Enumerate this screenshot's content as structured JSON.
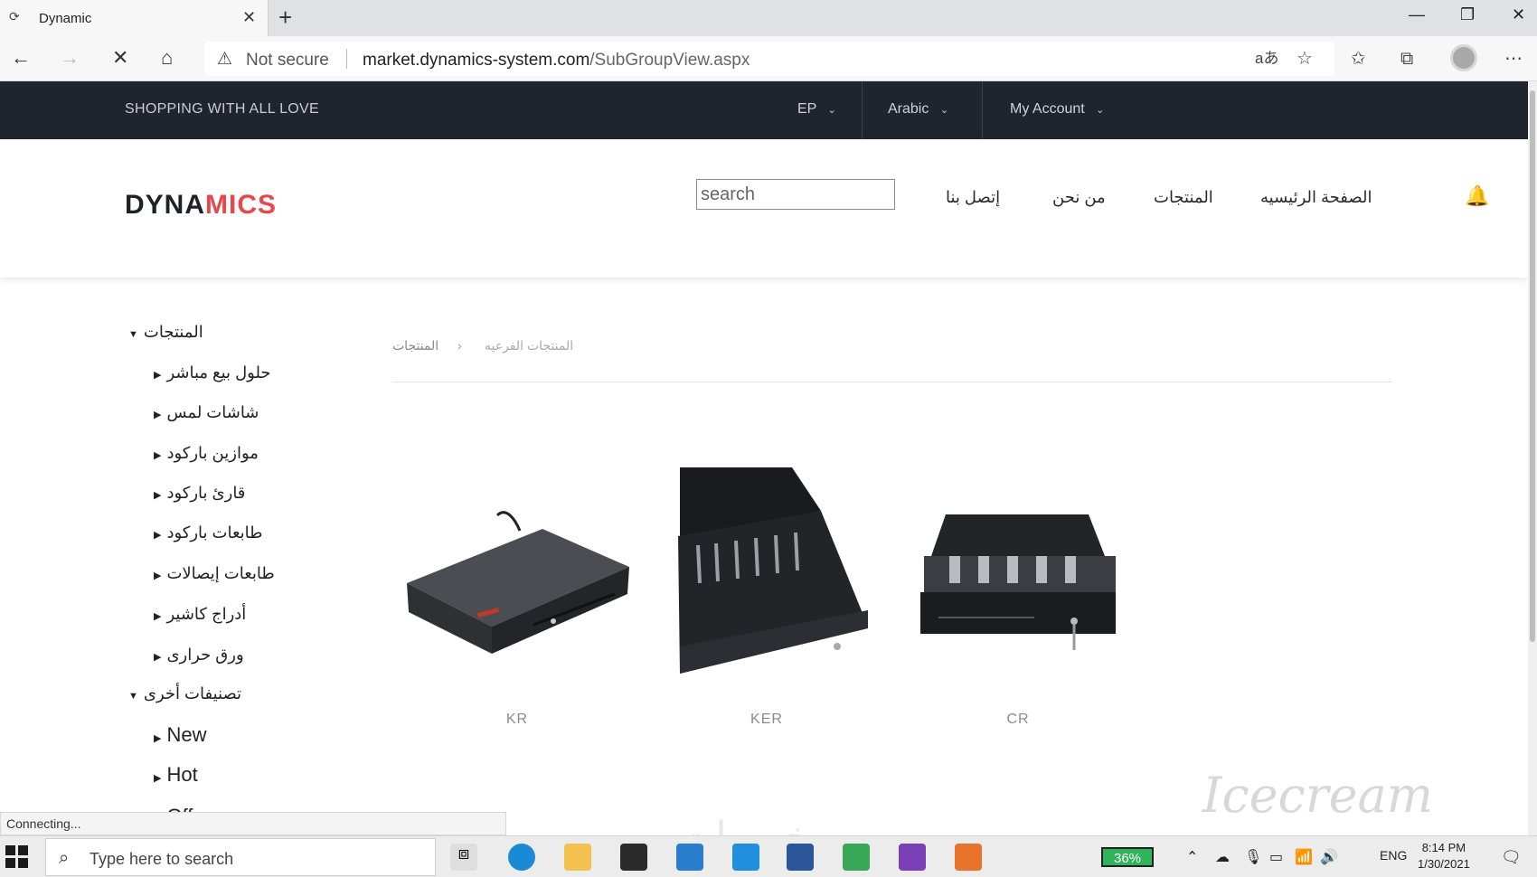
{
  "browser": {
    "tab_title": "Dynamic",
    "not_secure": "Not secure",
    "url_host": "market.dynamics-system.com",
    "url_path": "/SubGroupView.aspx"
  },
  "topbar": {
    "tagline": "SHOPPING WITH ALL LOVE",
    "currency": "EP",
    "language": "Arabic",
    "account": "My Account"
  },
  "header": {
    "logo_a": "DYNA",
    "logo_b": "MICS",
    "search_placeholder": "search",
    "menu": [
      "الصفحة الرئيسيه",
      "المنتجات",
      "من نحن",
      "إتصل بنا"
    ]
  },
  "sidebar": {
    "products_heading": "المنتجات",
    "product_items": [
      "حلول بيع مباشر",
      "شاشات لمس",
      "موازين باركود",
      "قارئ باركود",
      "طابعات باركود",
      "طابعات إيصالات",
      "أدراج كاشير",
      "ورق حرارى"
    ],
    "other_heading": "تصنيفات أخرى",
    "other_items": [
      "New",
      "Hot",
      "Offer"
    ]
  },
  "breadcrumb": {
    "root": "المنتجات",
    "current": "المنتجات الفرعيه"
  },
  "products": [
    {
      "name": "KR",
      "image": "cash-drawer-closed"
    },
    {
      "name": "KER",
      "image": "cash-drawer-open"
    },
    {
      "name": "CR",
      "image": "cash-drawer-tray"
    }
  ],
  "status": "Connecting...",
  "watermark": "Icecream",
  "watermark_ar": "خمسات",
  "taskbar": {
    "search_text": "Type here to search",
    "battery": "36%",
    "lang": "ENG",
    "time": "8:14 PM",
    "date": "1/30/2021"
  },
  "colors": {
    "accent": "#e8474c",
    "topbar": "#1f242e",
    "bell": "#e33b3b"
  }
}
